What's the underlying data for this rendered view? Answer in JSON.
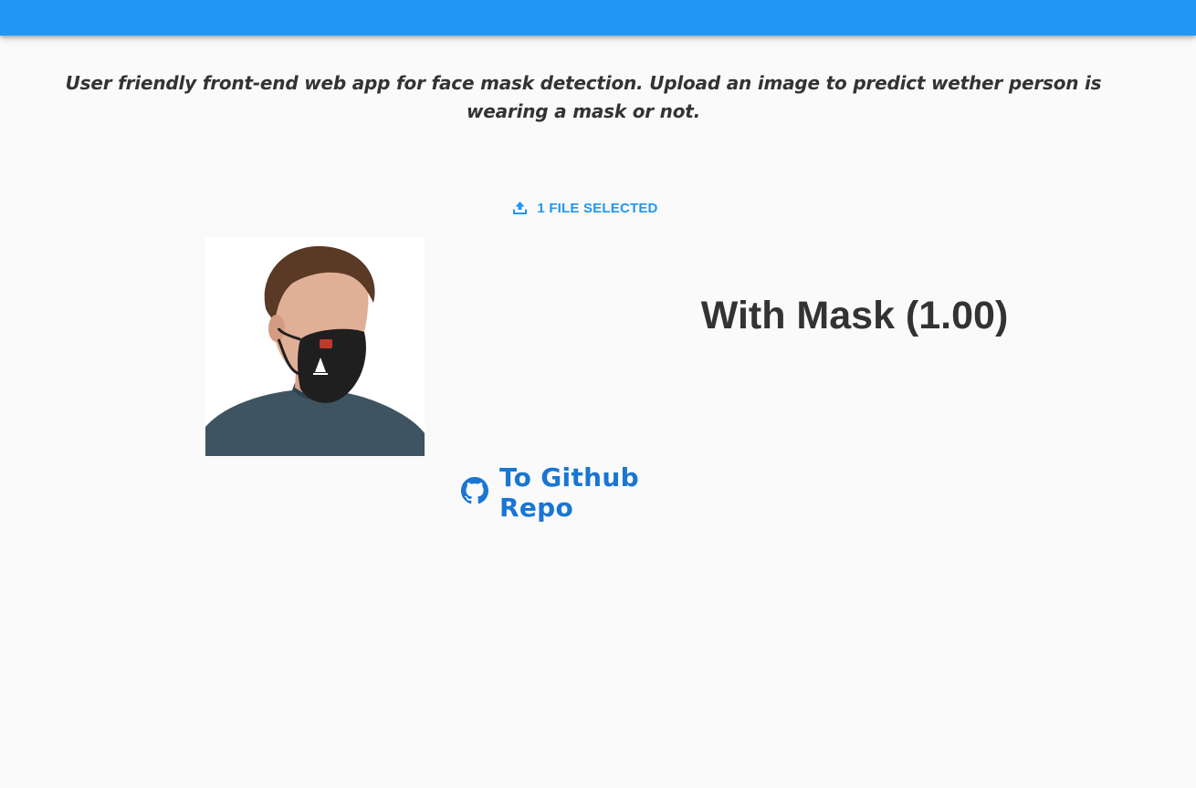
{
  "intro": {
    "text": "User friendly front-end web app for face mask detection. Upload an image to predict wether person is wearing a mask or not."
  },
  "upload": {
    "label": "1 FILE SELECTED",
    "icon": "upload-icon"
  },
  "prediction": {
    "text": "With Mask (1.00)"
  },
  "github": {
    "label": "To Github Repo",
    "icon": "github-icon"
  },
  "colors": {
    "appbar": "#2196f3",
    "accent": "#2196f3",
    "link": "#1976d2",
    "text": "#333333",
    "background": "#fafafa"
  }
}
